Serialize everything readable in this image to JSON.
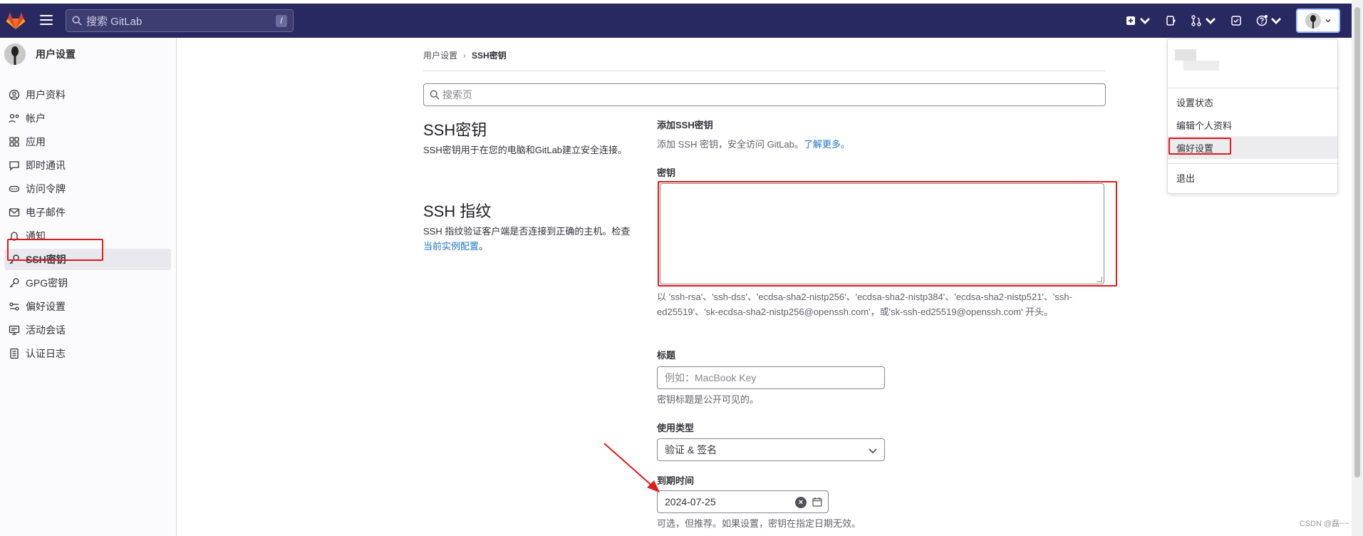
{
  "topbar": {
    "search_placeholder": "搜索 GitLab",
    "search_shortcut": "/"
  },
  "sidebar": {
    "title": "用户设置",
    "items": [
      {
        "label": "用户资料",
        "icon": "profile-icon"
      },
      {
        "label": "帐户",
        "icon": "account-icon"
      },
      {
        "label": "应用",
        "icon": "applications-icon"
      },
      {
        "label": "即时通讯",
        "icon": "chat-icon"
      },
      {
        "label": "访问令牌",
        "icon": "token-icon"
      },
      {
        "label": "电子邮件",
        "icon": "email-icon"
      },
      {
        "label": "通知",
        "icon": "bell-icon"
      },
      {
        "label": "SSH密钥",
        "icon": "key-icon",
        "active": true
      },
      {
        "label": "GPG密钥",
        "icon": "key-icon"
      },
      {
        "label": "偏好设置",
        "icon": "preferences-icon"
      },
      {
        "label": "活动会话",
        "icon": "monitor-icon"
      },
      {
        "label": "认证日志",
        "icon": "log-icon"
      }
    ]
  },
  "breadcrumb": {
    "parent": "用户设置",
    "separator": "›",
    "current": "SSH密钥"
  },
  "page_search_placeholder": "搜索页",
  "left": {
    "ssh_title": "SSH密钥",
    "ssh_desc": "SSH密钥用于在您的电脑和GitLab建立安全连接。",
    "fp_title": "SSH 指纹",
    "fp_desc": "SSH 指纹验证客户端是否连接到正确的主机。检查",
    "fp_link": "当前实例配置",
    "fp_end": "。"
  },
  "form": {
    "add_title": "添加SSH密钥",
    "add_desc": "添加 SSH 密钥，安全访问 GitLab。",
    "learn_more": "了解更多。",
    "key_label": "密钥",
    "key_value": "",
    "key_help": "以 'ssh-rsa'、'ssh-dss'、'ecdsa-sha2-nistp256'、'ecdsa-sha2-nistp384'、'ecdsa-sha2-nistp521'、'ssh-ed25519'、'sk-ecdsa-sha2-nistp256@openssh.com'，或'sk-ssh-ed25519@openssh.com' 开头。",
    "title_label": "标题",
    "title_placeholder": "例如：MacBook Key",
    "title_help": "密钥标题是公开可见的。",
    "usage_label": "使用类型",
    "usage_value": "验证 & 签名",
    "expiry_label": "到期时间",
    "expiry_value": "2024-07-25",
    "expiry_help": "可选，但推荐。如果设置，密钥在指定日期无效。"
  },
  "dropdown": {
    "items": [
      "设置状态",
      "编辑个人资料",
      "偏好设置",
      "退出"
    ]
  },
  "watermark": "CSDN @磊~~",
  "colors": {
    "topbar": "#292961",
    "link": "#1f75cb",
    "highlight_box": "#e11a1a"
  }
}
